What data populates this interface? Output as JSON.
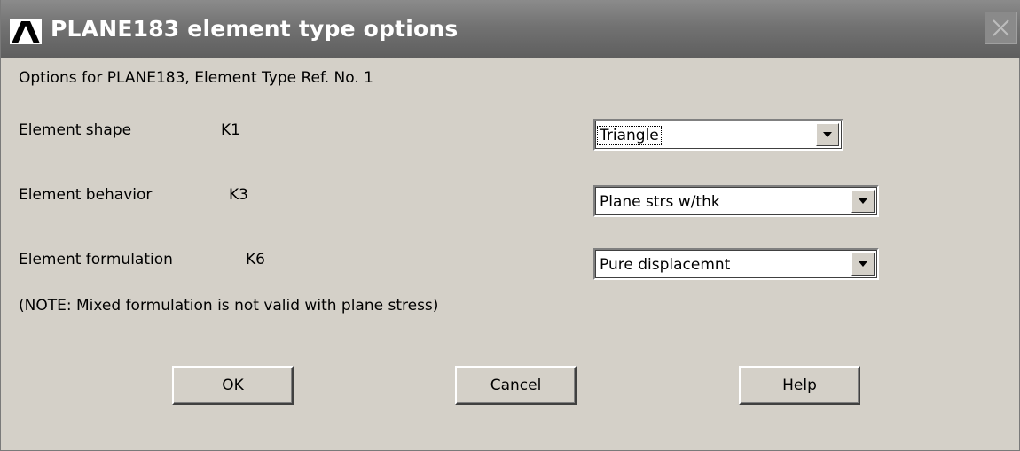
{
  "window": {
    "title": "PLANE183 element type options",
    "logo_icon": "ansys-logo-icon",
    "close_icon": "close-icon"
  },
  "header": {
    "options_text": "Options for PLANE183, Element Type Ref. No. 1"
  },
  "options": [
    {
      "label": "Element shape",
      "key": "K1",
      "value": "Triangle",
      "focused": true
    },
    {
      "label": "Element behavior",
      "key": "K3",
      "value": "Plane strs w/thk",
      "focused": false
    },
    {
      "label": "Element formulation",
      "key": "K6",
      "value": "Pure displacemnt",
      "focused": false
    }
  ],
  "note": "(NOTE: Mixed formulation is not valid with plane stress)",
  "buttons": {
    "ok": "OK",
    "cancel": "Cancel",
    "help": "Help"
  },
  "colors": {
    "titlebar": "#6e6e6e",
    "dialog_bg": "#d4d0c8"
  }
}
